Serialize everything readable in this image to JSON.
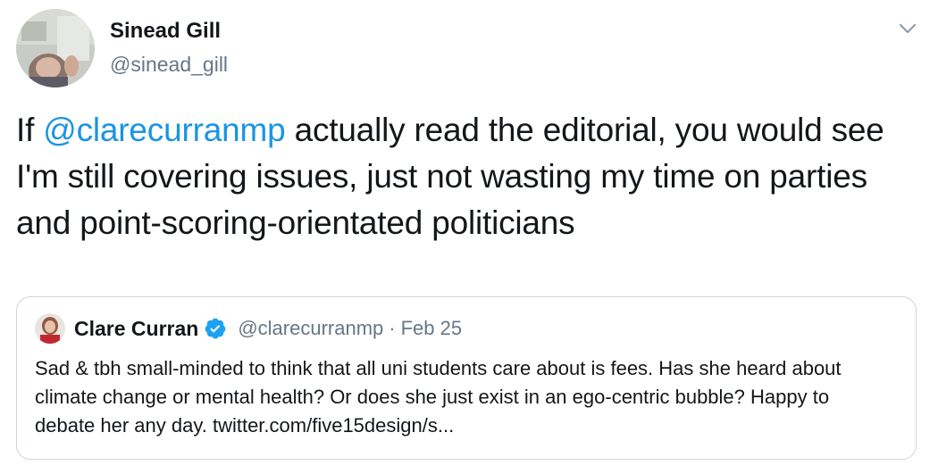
{
  "author": {
    "display_name": "Sinead Gill",
    "handle": "@sinead_gill"
  },
  "tweet": {
    "text_prefix": "If ",
    "mention": "@clarecurranmp",
    "text_suffix": " actually read the editorial, you would see I'm still covering issues, just not wasting my time on parties and point-scoring-orientated politicians"
  },
  "quoted_tweet": {
    "display_name": "Clare Curran",
    "verified": true,
    "handle": "@clarecurranmp",
    "separator": "·",
    "date": "Feb 25",
    "text": "Sad & tbh small-minded to think that all uni students care about is fees. Has she heard about climate change or mental health? Or does she just exist in an ego-centric bubble? Happy to debate her any day. twitter.com/five15design/s..."
  },
  "icons": {
    "menu": "chevron-down-icon",
    "verified": "verified-badge-icon"
  },
  "colors": {
    "link": "#1b95e0",
    "secondary_text": "#657786",
    "border": "#ccd6dd",
    "verified": "#1da1f2"
  }
}
